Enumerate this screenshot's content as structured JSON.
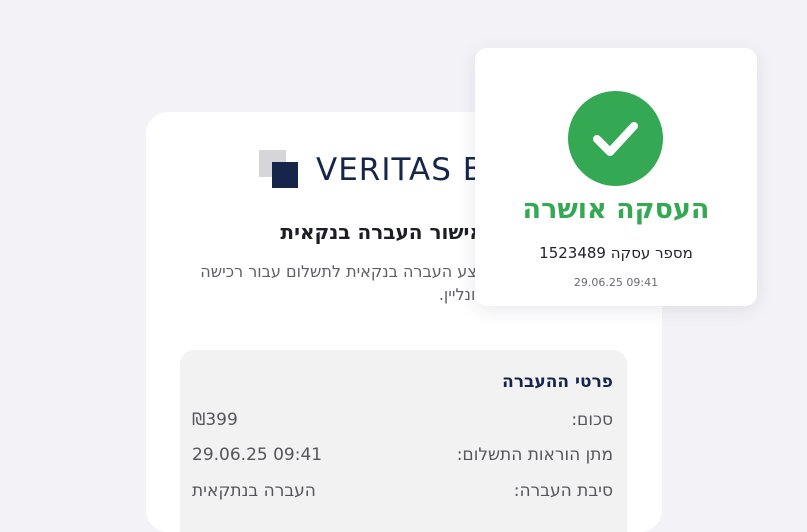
{
  "brand": {
    "name": "VERITAS B",
    "logo_colors": {
      "back": "#d6d6da",
      "front": "#16264a"
    }
  },
  "payment": {
    "heading": "אישור העברה בנקאית",
    "description": "בצע העברה בנקאית לתשלום עבור רכישה אונליין."
  },
  "details": {
    "title": "פרטי ההעברה",
    "rows": [
      {
        "label": "סכום:",
        "value": "₪399"
      },
      {
        "label": "מתן הוראות התשלום:",
        "value": "29.06.25 09:41"
      },
      {
        "label": "סיבת העברה:",
        "value": "העברה בנתקאית"
      }
    ]
  },
  "success": {
    "icon": "check-icon",
    "title": "העסקה אושרה",
    "transaction_label": "מספר עסקה",
    "transaction_number": "1523489",
    "timestamp": "29.06.25 09:41",
    "color": "#34a853"
  }
}
